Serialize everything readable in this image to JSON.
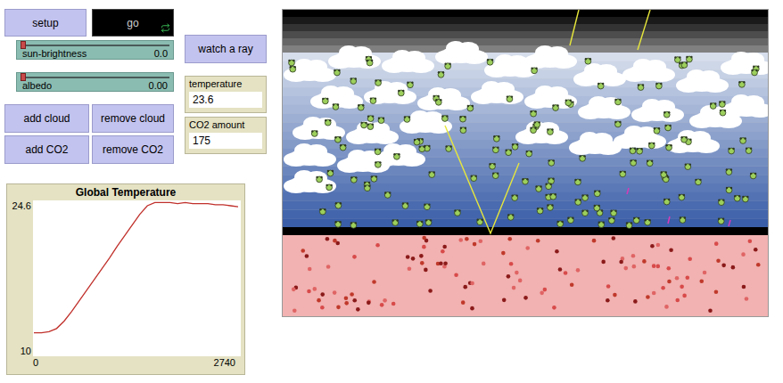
{
  "controls": {
    "setup": {
      "label": "setup"
    },
    "go": {
      "label": "go",
      "running": true
    },
    "sliders": [
      {
        "name": "sun-brightness",
        "value": "0.0",
        "level": 0
      },
      {
        "name": "albedo",
        "value": "0.00",
        "level": 0
      }
    ],
    "cloud_buttons": [
      "add cloud",
      "remove cloud"
    ],
    "co2_buttons": [
      "add CO2",
      "remove CO2"
    ],
    "watch": "watch a ray"
  },
  "monitors": [
    {
      "label": "temperature",
      "value": "23.6"
    },
    {
      "label": "CO2 amount",
      "value": "175"
    }
  ],
  "plot": {
    "title": "Global Temperature",
    "y_min": "10",
    "y_max": "24.6",
    "x_min": "0",
    "x_max": "2740",
    "series": [
      {
        "name": "temperature",
        "color": "#c0302b",
        "values": [
          12.2,
          12.2,
          12.3,
          12.6,
          13.3,
          14.2,
          15.2,
          16.2,
          17.2,
          18.2,
          19.2,
          20.3,
          21.3,
          22.3,
          23.3,
          24.1,
          24.4,
          24.4,
          24.4,
          24.3,
          24.4,
          24.3,
          24.3,
          24.3,
          24.2,
          24.2,
          24.1,
          24.0
        ]
      }
    ]
  }
}
